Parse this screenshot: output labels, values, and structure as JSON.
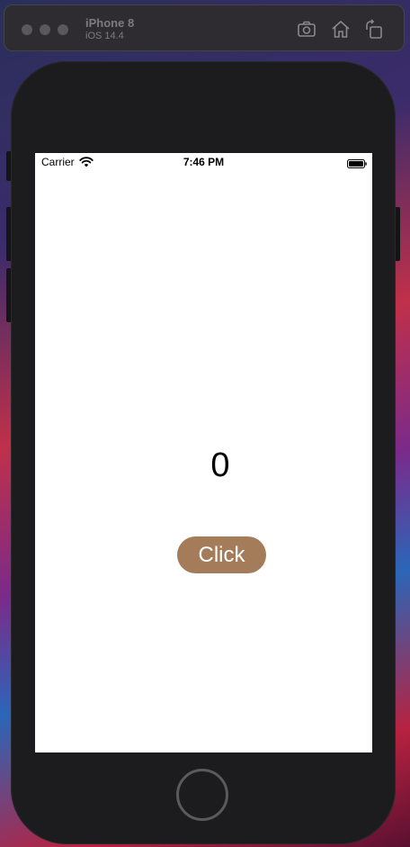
{
  "simulator": {
    "device_name": "iPhone 8",
    "os_version": "iOS 14.4",
    "toolbar_icons": [
      "screenshot-icon",
      "home-icon",
      "rotate-icon"
    ]
  },
  "status_bar": {
    "carrier": "Carrier",
    "time": "7:46 PM"
  },
  "app": {
    "counter_value": "0",
    "button_label": "Click",
    "button_color": "#a47c5a"
  }
}
